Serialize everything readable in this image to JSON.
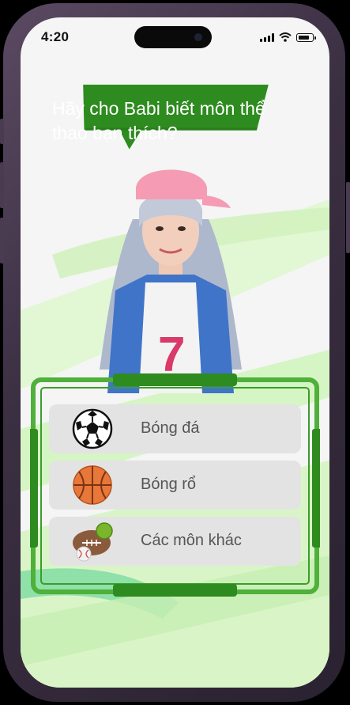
{
  "status_bar": {
    "time": "4:20",
    "battery_level": 0.85
  },
  "prompt": {
    "text": "Hãy cho Babi biết môn thể thao bạn thích?"
  },
  "options": [
    {
      "label": "Bóng đá",
      "icon": "soccer-ball-icon"
    },
    {
      "label": "Bóng rổ",
      "icon": "basketball-icon"
    },
    {
      "label": "Các môn khác",
      "icon": "other-sports-icon"
    }
  ],
  "colors": {
    "accent_green": "#2e8b1f",
    "panel_green": "#4fb03a",
    "option_bg": "#e3e3e3"
  }
}
